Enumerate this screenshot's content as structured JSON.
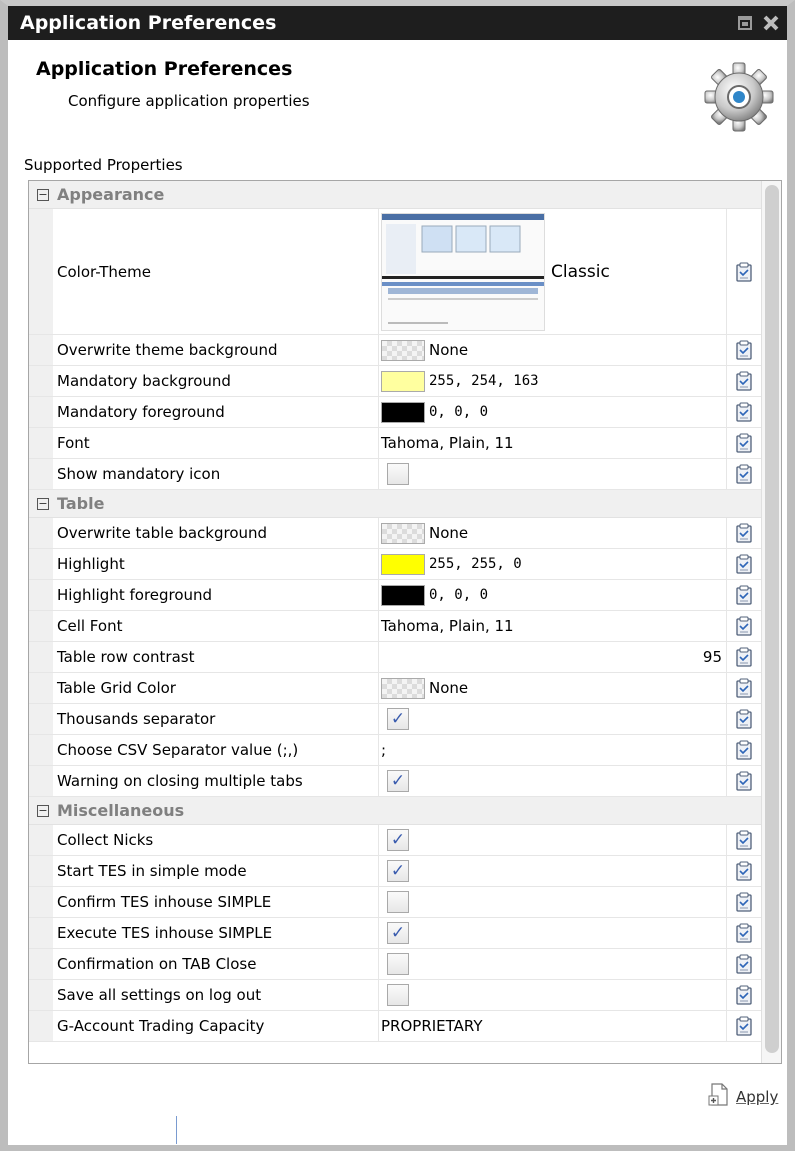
{
  "window": {
    "title": "Application Preferences"
  },
  "header": {
    "title": "Application Preferences",
    "subtitle": "Configure application properties",
    "icon": "gear-icon"
  },
  "section_label": "Supported Properties",
  "groups": [
    {
      "name": "Appearance",
      "rows": [
        {
          "label": "Color-Theme",
          "type": "theme",
          "value": "Classic"
        },
        {
          "label": "Overwrite theme background",
          "type": "color",
          "swatch": "none",
          "value": "None"
        },
        {
          "label": "Mandatory background",
          "type": "color",
          "swatch": "#ffff9f",
          "value": "255, 254, 163"
        },
        {
          "label": "Mandatory foreground",
          "type": "color",
          "swatch": "#000000",
          "value": "0, 0, 0"
        },
        {
          "label": "Font",
          "type": "text",
          "value": "Tahoma, Plain, 11"
        },
        {
          "label": "Show mandatory icon",
          "type": "checkbox",
          "checked": false
        }
      ]
    },
    {
      "name": "Table",
      "rows": [
        {
          "label": "Overwrite table background",
          "type": "color",
          "swatch": "none",
          "value": "None"
        },
        {
          "label": "Highlight",
          "type": "color",
          "swatch": "#ffff00",
          "value": "255, 255, 0"
        },
        {
          "label": "Highlight foreground",
          "type": "color",
          "swatch": "#000000",
          "value": "0, 0, 0"
        },
        {
          "label": "Cell Font",
          "type": "text",
          "value": "Tahoma, Plain, 11"
        },
        {
          "label": "Table row contrast",
          "type": "number",
          "value": "95"
        },
        {
          "label": "Table Grid Color",
          "type": "color",
          "swatch": "none",
          "value": "None"
        },
        {
          "label": "Thousands separator",
          "type": "checkbox",
          "checked": true
        },
        {
          "label": "Choose CSV Separator value (;,)",
          "type": "text",
          "value": ";"
        },
        {
          "label": "Warning on closing multiple tabs",
          "type": "checkbox",
          "checked": true
        }
      ]
    },
    {
      "name": "Miscellaneous",
      "rows": [
        {
          "label": "Collect Nicks",
          "type": "checkbox",
          "checked": true
        },
        {
          "label": "Start TES in simple mode",
          "type": "checkbox",
          "checked": true
        },
        {
          "label": "Confirm TES inhouse SIMPLE",
          "type": "checkbox",
          "checked": false
        },
        {
          "label": "Execute TES inhouse SIMPLE",
          "type": "checkbox",
          "checked": true
        },
        {
          "label": "Confirmation on TAB Close",
          "type": "checkbox",
          "checked": false
        },
        {
          "label": "Save all settings on log out",
          "type": "checkbox",
          "checked": false
        },
        {
          "label": "G-Account Trading Capacity",
          "type": "text",
          "value": "PROPRIETARY"
        }
      ]
    }
  ],
  "apply_label": "Apply"
}
